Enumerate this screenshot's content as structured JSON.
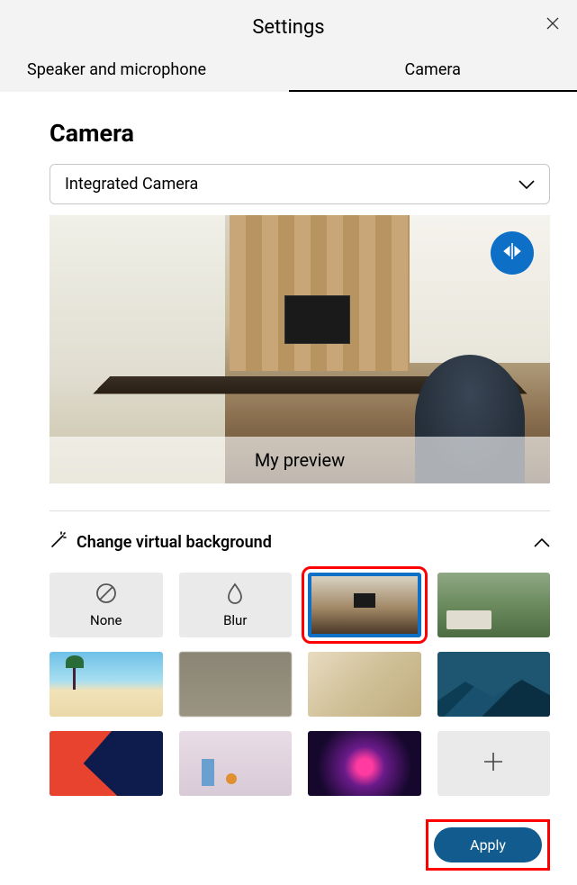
{
  "dialog": {
    "title": "Settings",
    "close_label": "Close"
  },
  "tabs": {
    "speaker_mic": "Speaker and microphone",
    "camera": "Camera",
    "active": "camera"
  },
  "camera": {
    "section_title": "Camera",
    "device_select": "Integrated Camera",
    "preview_label": "My preview",
    "mirror_label": "Mirror"
  },
  "virtual_bg": {
    "section_label": "Change virtual background",
    "expanded": true,
    "items": [
      {
        "id": "none",
        "label": "None",
        "kind": "icon-label",
        "selected": false
      },
      {
        "id": "blur",
        "label": "Blur",
        "kind": "icon-label",
        "selected": false
      },
      {
        "id": "office",
        "label": "",
        "kind": "thumb",
        "selected": true
      },
      {
        "id": "forest",
        "label": "",
        "kind": "thumb",
        "selected": false
      },
      {
        "id": "beach",
        "label": "",
        "kind": "thumb",
        "selected": false
      },
      {
        "id": "blurroom",
        "label": "",
        "kind": "thumb",
        "selected": false
      },
      {
        "id": "lightblur",
        "label": "",
        "kind": "thumb",
        "selected": false
      },
      {
        "id": "mountains",
        "label": "",
        "kind": "thumb",
        "selected": false
      },
      {
        "id": "redblue",
        "label": "",
        "kind": "thumb",
        "selected": false
      },
      {
        "id": "pastel",
        "label": "",
        "kind": "thumb",
        "selected": false
      },
      {
        "id": "neon",
        "label": "",
        "kind": "thumb",
        "selected": false
      },
      {
        "id": "add",
        "label": "",
        "kind": "add",
        "selected": false
      }
    ]
  },
  "footer": {
    "apply_label": "Apply"
  },
  "colors": {
    "accent": "#0e6fc7",
    "highlight": "#ff0000",
    "apply_button": "#115b8e"
  }
}
